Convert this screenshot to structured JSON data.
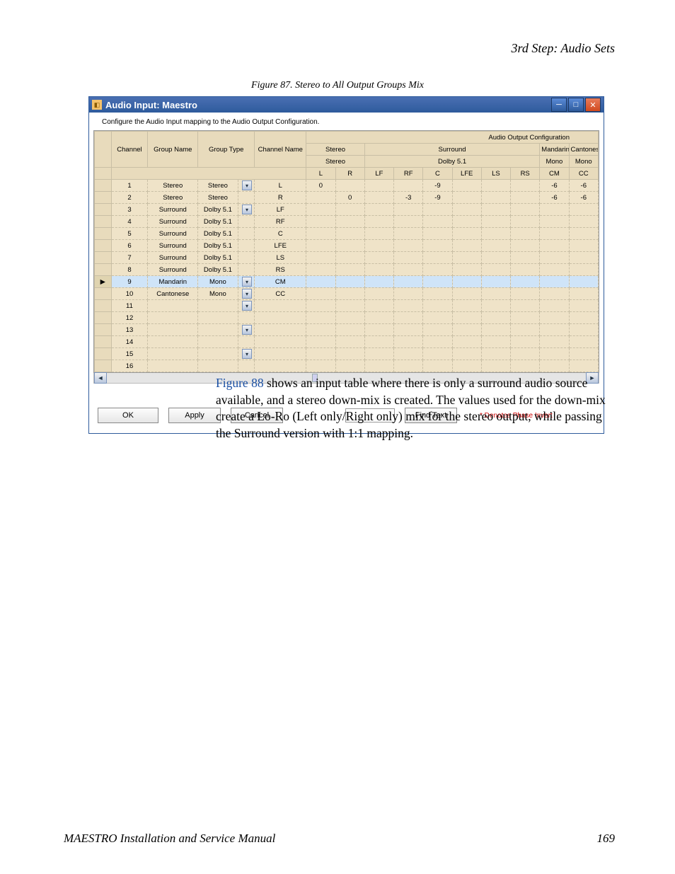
{
  "header": {
    "section_title": "3rd Step: Audio Sets"
  },
  "figure": {
    "caption": "Figure 87.  Stereo to All Output Groups Mix"
  },
  "window": {
    "title": "Audio Input: Maestro",
    "instruction": "Configure the Audio Input mapping to the Audio Output Configuration.",
    "out_config_label": "Audio Output Configuration",
    "groups": [
      {
        "name": "Stereo",
        "type": "Stereo",
        "cols": [
          "L",
          "R"
        ]
      },
      {
        "name": "Surround",
        "type": "Dolby 5.1",
        "cols": [
          "LF",
          "RF",
          "C",
          "LFE",
          "LS",
          "RS"
        ]
      },
      {
        "name": "Mandarin",
        "type": "Mono",
        "cols": [
          "CM"
        ]
      },
      {
        "name": "Cantonese",
        "type": "Mono",
        "cols": [
          "CC"
        ]
      }
    ],
    "col_headers": {
      "channel": "Channel",
      "group_name": "Group Name",
      "group_type": "Group Type",
      "channel_name": "Channel Name"
    },
    "rows": [
      {
        "ch": "1",
        "gn": "Stereo",
        "gt": "Stereo",
        "dd": true,
        "cn": "L",
        "vals": {
          "L": "0",
          "C": "-9",
          "CM": "-6",
          "CC": "-6"
        }
      },
      {
        "ch": "2",
        "gn": "Stereo",
        "gt": "Stereo",
        "cn": "R",
        "vals": {
          "R": "0",
          "RF": "-3",
          "C": "-9",
          "CM": "-6",
          "CC": "-6"
        }
      },
      {
        "ch": "3",
        "gn": "Surround",
        "gt": "Dolby 5.1",
        "dd": true,
        "cn": "LF",
        "vals": {}
      },
      {
        "ch": "4",
        "gn": "Surround",
        "gt": "Dolby 5.1",
        "cn": "RF",
        "vals": {}
      },
      {
        "ch": "5",
        "gn": "Surround",
        "gt": "Dolby 5.1",
        "cn": "C",
        "vals": {}
      },
      {
        "ch": "6",
        "gn": "Surround",
        "gt": "Dolby 5.1",
        "cn": "LFE",
        "vals": {}
      },
      {
        "ch": "7",
        "gn": "Surround",
        "gt": "Dolby 5.1",
        "cn": "LS",
        "vals": {}
      },
      {
        "ch": "8",
        "gn": "Surround",
        "gt": "Dolby 5.1",
        "cn": "RS",
        "vals": {}
      },
      {
        "ch": "9",
        "gn": "Mandarin",
        "gt": "Mono",
        "dd": true,
        "cn": "CM",
        "vals": {},
        "selected": true
      },
      {
        "ch": "10",
        "gn": "Cantonese",
        "gt": "Mono",
        "dd": true,
        "cn": "CC",
        "vals": {}
      },
      {
        "ch": "11",
        "gn": "",
        "gt": "",
        "dd": true,
        "cn": "",
        "vals": {}
      },
      {
        "ch": "12",
        "gn": "",
        "gt": "",
        "cn": "",
        "vals": {}
      },
      {
        "ch": "13",
        "gn": "",
        "gt": "",
        "dd": true,
        "cn": "",
        "vals": {}
      },
      {
        "ch": "14",
        "gn": "",
        "gt": "",
        "cn": "",
        "vals": {}
      },
      {
        "ch": "15",
        "gn": "",
        "gt": "",
        "dd": true,
        "cn": "",
        "vals": {}
      },
      {
        "ch": "16",
        "gn": "",
        "gt": "",
        "cn": "",
        "vals": {}
      }
    ],
    "buttons": {
      "ok": "OK",
      "apply": "Apply",
      "cancel": "Cancel",
      "find_text": "Find Text"
    },
    "phase_invert_note": "* Denotes Phase Invert"
  },
  "body": {
    "figref": "Figure 88",
    "text_after": " shows an input table where there is only a surround audio source available, and a stereo down-mix is created. The values used for the down-mix create a Lo-Ro (Left only/Right only) mix for the stereo output, while passing the Surround version with 1:1 mapping."
  },
  "footer": {
    "manual_title": "MAESTRO Installation and Service Manual",
    "page_number": "169"
  }
}
